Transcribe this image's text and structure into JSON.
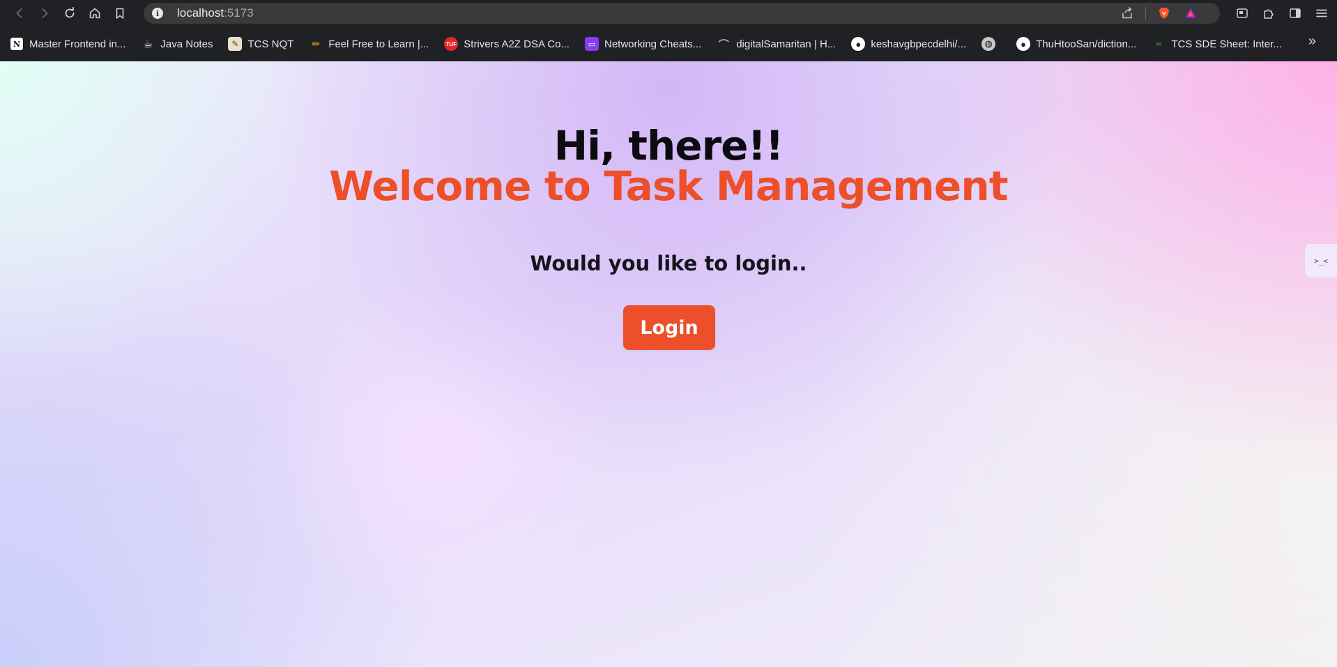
{
  "browser": {
    "url_host": "localhost",
    "url_port": ":5173",
    "bookmarks": [
      {
        "label": "Master Frontend in...",
        "icon": "notion-icon",
        "color": "#ffffff"
      },
      {
        "label": "Java Notes",
        "icon": "coffee-icon",
        "color": "#d9a05b"
      },
      {
        "label": "TCS NQT",
        "icon": "memo-icon",
        "color": "#f2c46d"
      },
      {
        "label": "Feel Free to Learn |...",
        "icon": "pencil-icon",
        "color": "#f0b400"
      },
      {
        "label": "Strivers A2Z DSA Co...",
        "icon": "tuf-icon",
        "color": "#e0262c"
      },
      {
        "label": "Networking Cheats...",
        "icon": "monitor-icon",
        "color": "#8a3bf0"
      },
      {
        "label": "digitalSamaritan | H...",
        "icon": "script-icon",
        "color": "#b0b0b0"
      },
      {
        "label": "keshavgbpecdelhi/...",
        "icon": "github-icon",
        "color": "#ffffff"
      },
      {
        "label": "",
        "icon": "globe-icon",
        "color": "#c8c8c8"
      },
      {
        "label": "ThuHtooSan/diction...",
        "icon": "github-icon",
        "color": "#ffffff"
      },
      {
        "label": "TCS SDE Sheet: Inter...",
        "icon": "gfg-icon",
        "color": "#2f8d46"
      }
    ],
    "more_label": "»"
  },
  "hero": {
    "greeting": "Hi, there!!",
    "welcome": "Welcome to Task Management",
    "prompt": "Would you like to login..",
    "login_label": "Login"
  },
  "side_widget": {
    "label": ">_<"
  },
  "colors": {
    "accent": "#ec4f2a",
    "chrome": "#202124"
  }
}
